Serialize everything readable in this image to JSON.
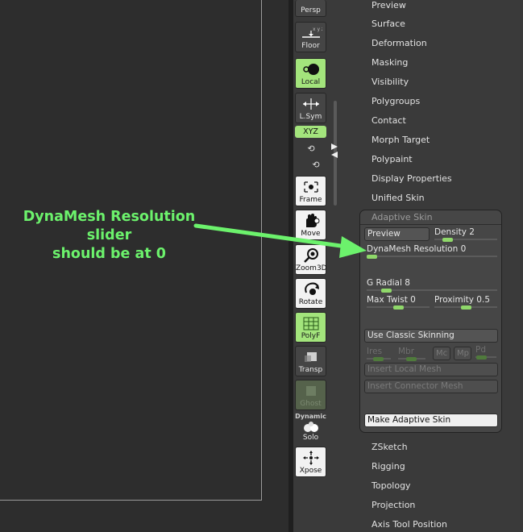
{
  "annotation": {
    "line1": "DynaMesh Resolution slider",
    "line2": "should be at 0"
  },
  "shelf": {
    "persp": "Persp",
    "floor": "Floor",
    "local": "Local",
    "lsym": "L.Sym",
    "xyz": "XYZ",
    "frame": "Frame",
    "move": "Move",
    "zoom3d": "Zoom3D",
    "rotate": "Rotate",
    "polyf": "PolyF",
    "transp": "Transp",
    "ghost": "Ghost",
    "dynamic": "Dynamic",
    "solo": "Solo",
    "xpose": "Xpose"
  },
  "panel_top": [
    "Preview",
    "Surface",
    "Deformation",
    "Masking",
    "Visibility",
    "Polygroups",
    "Contact",
    "Morph Target",
    "Polypaint",
    "Display Properties",
    "Unified Skin"
  ],
  "adaptive": {
    "title": "Adaptive Skin",
    "preview": "Preview",
    "density_label": "Density",
    "density_value": "2",
    "density_level": 0.15,
    "dyna_label": "DynaMesh Resolution",
    "dyna_value": "0",
    "dyna_level": 0.0,
    "gradial_label": "G Radial",
    "gradial_value": "8",
    "gradial_level": 0.12,
    "maxtwist_label": "Max Twist",
    "maxtwist_value": "0",
    "maxtwist_level": 0.5,
    "proximity_label": "Proximity",
    "proximity_value": "0.5",
    "proximity_level": 0.5,
    "classic": "Use Classic Skinning",
    "ires": "Ires",
    "mbr": "Mbr",
    "mc": "Mc",
    "mp": "Mp",
    "pd": "Pd",
    "insert_local": "Insert Local Mesh",
    "insert_connector": "Insert Connector Mesh",
    "make": "Make Adaptive Skin"
  },
  "panel_bottom": [
    "ZSketch",
    "Rigging",
    "Topology",
    "Projection",
    "Axis Tool Position"
  ],
  "colors": {
    "accent_green": "#a3e47c",
    "annotation_green": "#6cf26c"
  }
}
